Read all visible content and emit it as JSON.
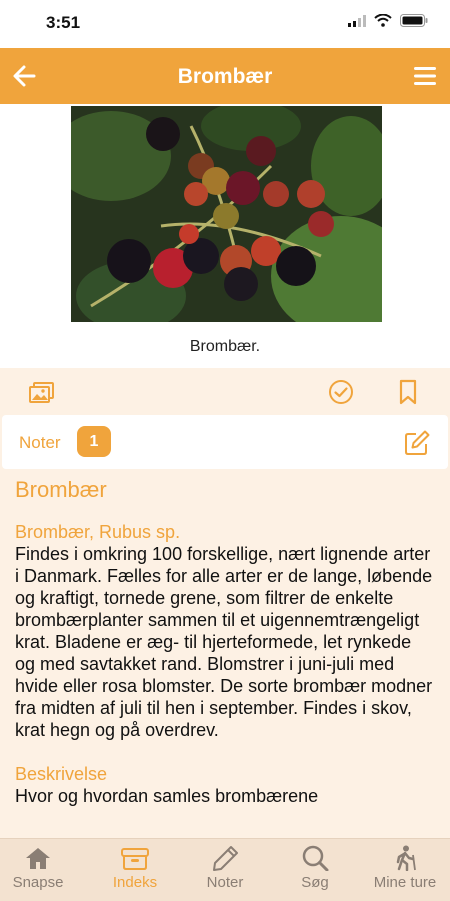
{
  "status_bar": {
    "time": "3:51"
  },
  "header": {
    "title": "Brombær"
  },
  "photo": {
    "caption": "Brombær."
  },
  "notes": {
    "label": "Noter",
    "count": "1"
  },
  "content": {
    "title": "Brombær",
    "sections": [
      {
        "title": "Brombær, Rubus sp.",
        "body": "Findes i omkring 100 forskellige, nært lignende arter i Danmark. Fælles for alle arter er de lange, løbende og kraftigt, tornede grene, som filtrer de enkelte brombærplanter sammen til et uigennemtrængeligt krat. Bladene er æg- til hjerteformede, let rynkede og med savtakket rand. Blomstrer i juni-juli med hvide eller rosa blomster. De sorte brombær modner fra midten af juli til hen i september. Findes i skov, krat hegn og på overdrev."
      },
      {
        "title": "Beskrivelse",
        "body": "Hvor og hvordan samles brombærene"
      }
    ]
  },
  "bottom_nav": [
    {
      "label": "Snapse",
      "icon": "home-icon"
    },
    {
      "label": "Indeks",
      "icon": "archive-box-icon"
    },
    {
      "label": "Noter",
      "icon": "pencil-icon"
    },
    {
      "label": "Søg",
      "icon": "search-icon"
    },
    {
      "label": "Mine ture",
      "icon": "hiker-icon"
    }
  ],
  "colors": {
    "accent": "#f0a43c",
    "background": "#fdf1e4",
    "nav_background": "#f3e2d0"
  }
}
